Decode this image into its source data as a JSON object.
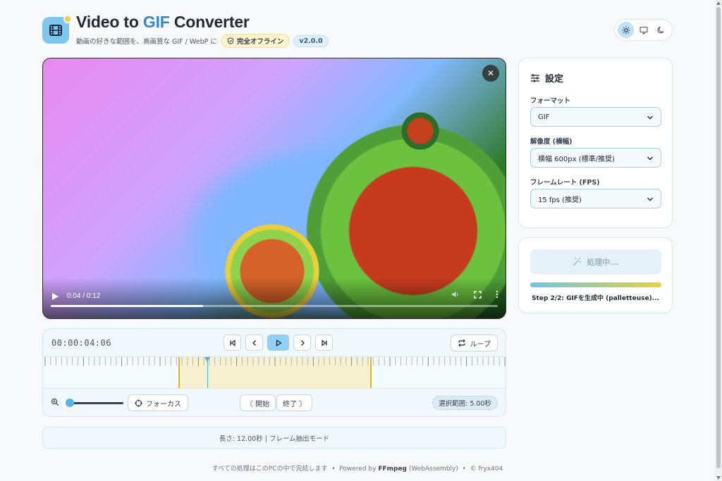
{
  "header": {
    "title_part1": "Video to ",
    "title_accent": "GIF",
    "title_part2": " Converter",
    "subtitle": "動画の好きな範囲を、高画質な GIF / WebP に",
    "offline_badge": "完全オフライン",
    "version_badge": "v2.0.0",
    "logo_icon": "film-icon",
    "theme_options": [
      "light",
      "system",
      "dark"
    ],
    "theme_selected": "light"
  },
  "video": {
    "time_display": "0:04 / 0:12",
    "progress": 0.34,
    "close_icon": "close-icon"
  },
  "timeline": {
    "timecode": "00:00:04:06",
    "loop_label": "ループ",
    "focus_label": "フォーカス",
    "start_label": "〘 開始",
    "end_label": "終了 〙",
    "range_label": "選択範囲: 5.00秒",
    "duration_seconds": 12,
    "selection_start_seconds": 3.5,
    "selection_end_seconds": 8.5,
    "playhead_seconds": 4.25,
    "zoom_level": 0.0
  },
  "info_bar": "長さ: 12.00秒 | フレーム抽出モード",
  "footer": {
    "text1": "すべての処理はこのPCの中で完結します",
    "sep": "•",
    "powered": "Powered by ",
    "ffmpeg": "FFmpeg",
    "wasm": " (WebAssembly)",
    "copyright": "© fryx404"
  },
  "settings": {
    "title": "設定",
    "format_label": "フォーマット",
    "format_value": "GIF",
    "resolution_label": "解像度 (横幅)",
    "resolution_value": "横幅 600px (標準/推奨)",
    "fps_label": "フレームレート (FPS)",
    "fps_value": "15 fps (推奨)"
  },
  "process": {
    "button_label": "処理中...",
    "progress": 1.0,
    "status": "Step 2/2: GIFを生成中 (palletteuse)..."
  },
  "colors": {
    "accent": "#3a86c8",
    "play_button": "#8fd0f4",
    "selection": "#f8f1cf",
    "selection_edge": "#e0b82b"
  }
}
